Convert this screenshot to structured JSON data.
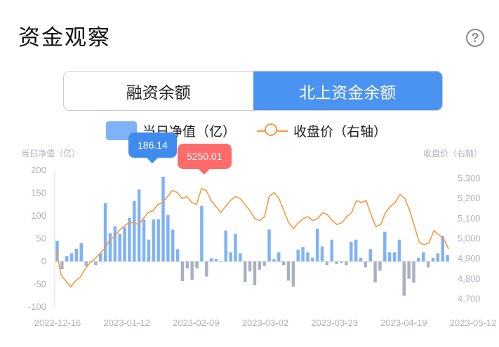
{
  "header": {
    "title": "资金观察",
    "help_icon": "?"
  },
  "tabs": [
    {
      "label": "融资余额",
      "active": false
    },
    {
      "label": "北上资金余额",
      "active": true
    }
  ],
  "legend": {
    "bar_label": "当日净值（亿）",
    "line_label": "收盘价（右轴）"
  },
  "axis": {
    "left_title": "当日净值（亿）",
    "right_title": "收盘价（右轴）"
  },
  "tooltips": {
    "bar_value": "186.14",
    "line_value": "5250.01"
  },
  "colors": {
    "positive_bar": "#7fb2f6",
    "negative_bar": "#a7b1c2",
    "line": "#f59a3e",
    "accent": "#4a93f0",
    "tip_red": "#ff6a6a"
  },
  "chart_data": {
    "type": "bar+line",
    "x_tick_labels": [
      "2022-12-16",
      "2023-01-12",
      "2023-02-09",
      "2023-03-02",
      "2023-03-23",
      "2023-04-19",
      "2023-05-12"
    ],
    "y_left_ticks": [
      200,
      150,
      100,
      50,
      0,
      -50,
      -100
    ],
    "y_right_ticks": [
      "5,300",
      "5,200",
      "5,100",
      "5,000",
      "4,900",
      "4,800",
      "4,700"
    ],
    "ylim_left": [
      -100,
      200
    ],
    "ylim_right": [
      4660,
      5340
    ],
    "series": [
      {
        "name": "当日净值（亿）",
        "type": "bar",
        "values": [
          45,
          -17,
          12,
          18,
          28,
          40,
          -10,
          0,
          -8,
          18,
          128,
          62,
          77,
          60,
          75,
          96,
          133,
          158,
          92,
          48,
          92,
          93,
          186.14,
          102,
          70,
          27,
          -43,
          -15,
          -40,
          -15,
          122,
          -33,
          7,
          6,
          0,
          68,
          20,
          60,
          18,
          -45,
          -22,
          -52,
          -18,
          -10,
          70,
          5,
          20,
          -8,
          -42,
          -55,
          26,
          32,
          20,
          8,
          72,
          33,
          -8,
          48,
          -6,
          -3,
          -8,
          43,
          48,
          8,
          -13,
          27,
          -46,
          -20,
          65,
          20,
          20,
          48,
          -75,
          -38,
          -47,
          8,
          20,
          -13,
          8,
          18,
          56,
          14
        ],
        "highlight_value": 186.14
      },
      {
        "name": "收盘价（右轴）",
        "type": "line",
        "values": [
          4945,
          4820,
          4790,
          4760,
          4790,
          4810,
          4850,
          4880,
          4900,
          4925,
          4950,
          4990,
          5010,
          5040,
          5060,
          5080,
          5080,
          5070,
          5100,
          5130,
          5140,
          5170,
          5180,
          5210,
          5240,
          5230,
          5200,
          5210,
          5180,
          5170,
          5250.01,
          5240,
          5190,
          5160,
          5130,
          5160,
          5190,
          5210,
          5200,
          5170,
          5140,
          5100,
          5090,
          5110,
          5210,
          5230,
          5200,
          5140,
          5080,
          5050,
          5080,
          5100,
          5110,
          5090,
          5100,
          5130,
          5120,
          5090,
          5070,
          5080,
          5110,
          5130,
          5190,
          5180,
          5190,
          5120,
          5060,
          5070,
          5130,
          5160,
          5180,
          5220,
          5200,
          5140,
          5060,
          4980,
          4970,
          4980,
          5040,
          5020,
          5000,
          4950
        ],
        "highlight_value": 5250.01
      }
    ]
  }
}
